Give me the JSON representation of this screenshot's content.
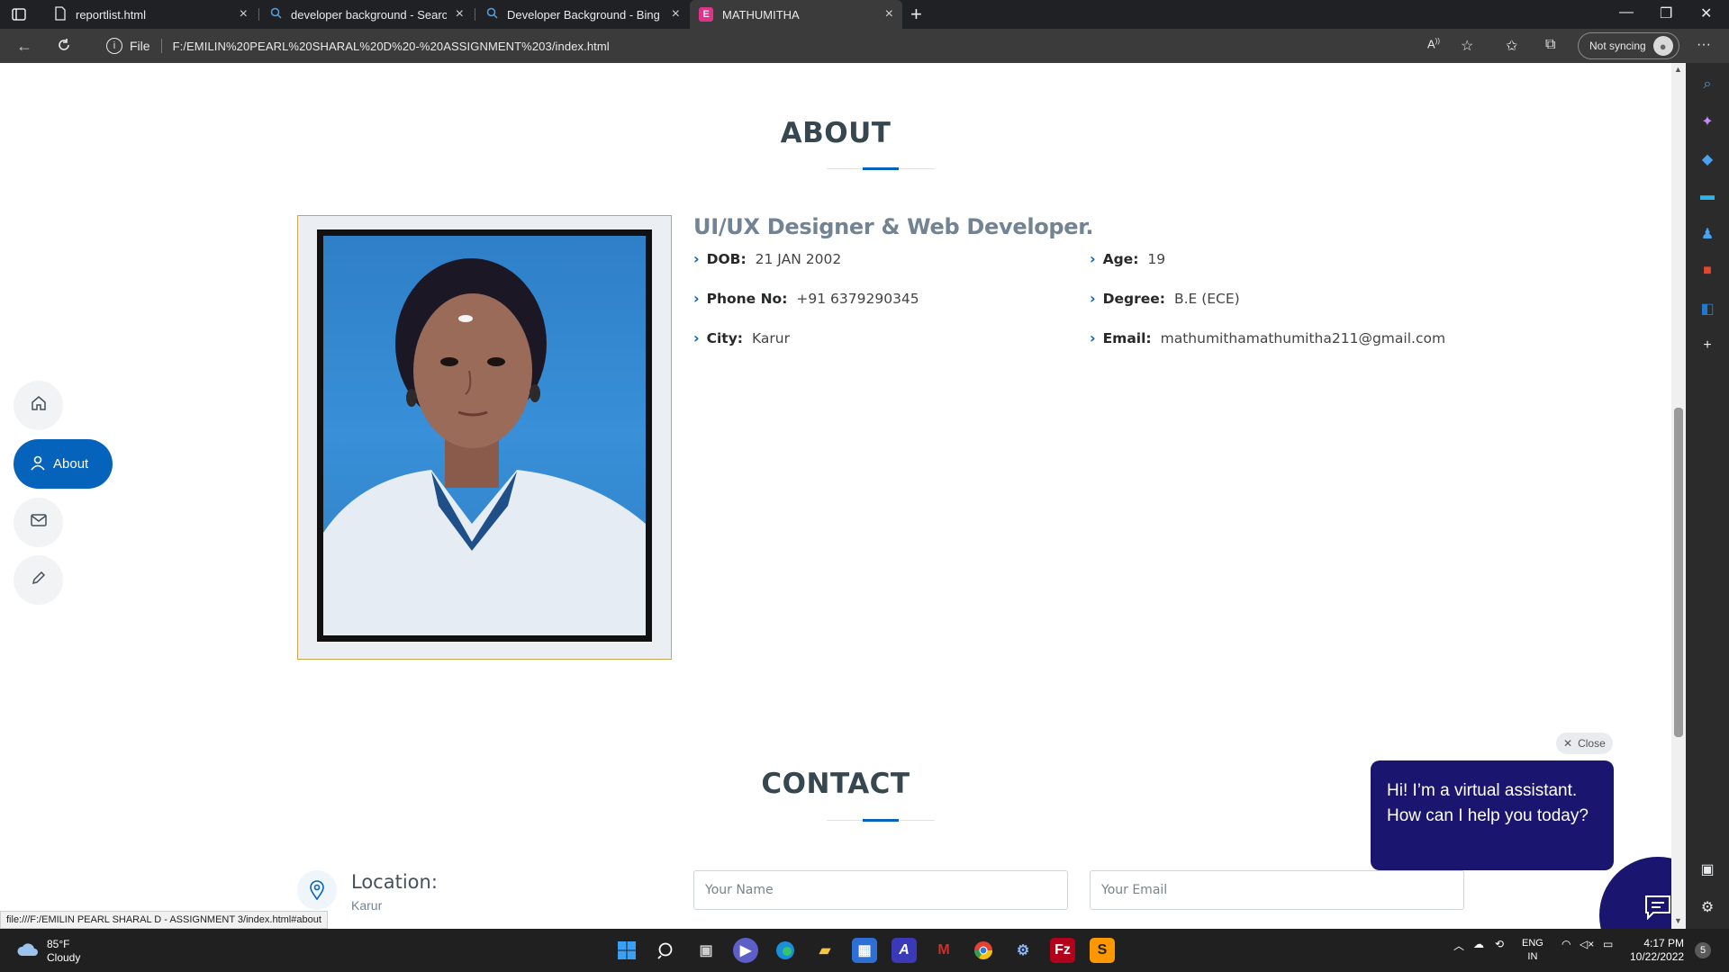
{
  "browser": {
    "tabs": [
      {
        "title": "reportlist.html",
        "icon": "file-icon",
        "active": false
      },
      {
        "title": "developer background - Search",
        "icon": "search-icon",
        "active": false
      },
      {
        "title": "Developer Background - Bing im",
        "icon": "search-icon",
        "active": false
      },
      {
        "title": "MATHUMITHA",
        "icon": "site-logo-icon",
        "active": true
      }
    ],
    "address": {
      "scheme_label": "File",
      "url": "F:/EMILIN%20PEARL%20SHARAL%20D%20-%20ASSIGNMENT%203/index.html"
    },
    "sync_label": "Not syncing"
  },
  "page": {
    "about": {
      "heading": "ABOUT",
      "role": "UI/UX Designer & Web Developer.",
      "details": [
        {
          "label": "DOB:",
          "value": "21 JAN 2002"
        },
        {
          "label": "Age:",
          "value": "19"
        },
        {
          "label": "Phone No:",
          "value": "+91 6379290345"
        },
        {
          "label": "Degree:",
          "value": "B.E (ECE)"
        },
        {
          "label": "City:",
          "value": "Karur"
        },
        {
          "label": "Email:",
          "value": "mathumithamathumitha211@gmail.com"
        }
      ]
    },
    "side_nav": {
      "items": [
        {
          "icon": "home-icon",
          "label": ""
        },
        {
          "icon": "user-icon",
          "label": "About"
        },
        {
          "icon": "mail-icon",
          "label": ""
        },
        {
          "icon": "pencil-icon",
          "label": ""
        }
      ]
    },
    "contact": {
      "heading": "CONTACT",
      "location_title": "Location:",
      "location_value": "Karur",
      "name_placeholder": "Your Name",
      "email_placeholder": "Your Email"
    },
    "assistant": {
      "close_label": "Close",
      "message": "Hi! I’m a virtual assistant. How can I help you today?"
    },
    "status_url": "file:///F:/EMILIN PEARL SHARAL D - ASSIGNMENT 3/index.html#about"
  },
  "taskbar": {
    "weather": {
      "temp": "85°F",
      "condition": "Cloudy"
    },
    "lang": {
      "line1": "ENG",
      "line2": "IN"
    },
    "time": "4:17 PM",
    "date": "10/22/2022",
    "notifications": "5"
  },
  "colors": {
    "accent": "#0563bb",
    "assistant": "#1a1670",
    "heading": "#37474f"
  }
}
